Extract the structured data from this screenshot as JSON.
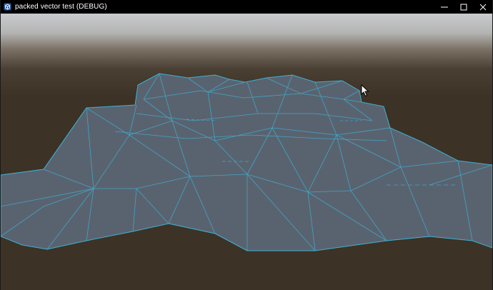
{
  "window": {
    "title": "packed vector test (DEBUG)",
    "icon": "unity-cube-icon",
    "controls": [
      "minimize-icon",
      "maximize-icon",
      "close-icon"
    ]
  },
  "scene": {
    "sky_color_top": "#c9cbcf",
    "sky_color_horizon": "#3c3226",
    "ground_color": "#3c3226",
    "mesh_fill": "#596370",
    "wireframe_color": "#3fb0d3"
  },
  "cursor": "arrow-cursor-icon"
}
